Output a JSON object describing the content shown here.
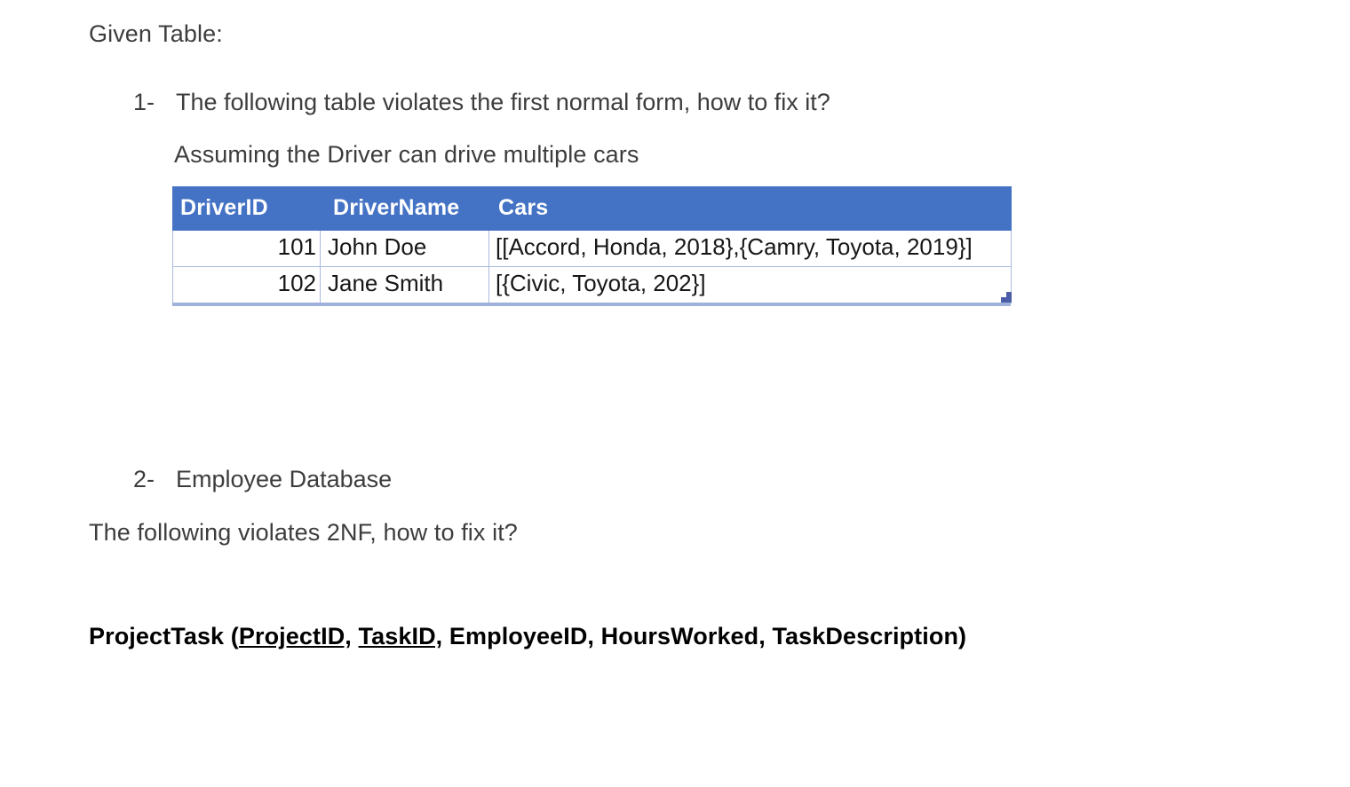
{
  "document": {
    "heading": "Given Table:",
    "questions": [
      {
        "marker": "1-",
        "text": "The following table violates the first normal form, how to fix it?",
        "note": "Assuming the Driver can drive multiple cars"
      },
      {
        "marker": "2-",
        "text": "Employee Database",
        "note": "The following violates 2NF, how to fix it?"
      }
    ],
    "driver_table": {
      "headers": [
        "DriverID",
        "DriverName",
        "Cars"
      ],
      "rows": [
        {
          "DriverID": "101",
          "DriverName": "John Doe",
          "Cars": "[[Accord, Honda, 2018},{Camry, Toyota, 2019}]"
        },
        {
          "DriverID": "102",
          "DriverName": "Jane Smith",
          "Cars": "[{Civic, Toyota, 202}]"
        }
      ],
      "header_fill": "#4472C4",
      "header_text_color": "#FFFFFF",
      "border_color": "#A9BADE"
    },
    "schema": {
      "relation": "ProjectTask",
      "open_paren": " (",
      "primary_keys": [
        "ProjectID,",
        "TaskID,"
      ],
      "attributes": " EmployeeID, HoursWorked, TaskDescription)",
      "full_text": "ProjectTask (ProjectID, TaskID, EmployeeID, HoursWorked, TaskDescription)"
    }
  }
}
